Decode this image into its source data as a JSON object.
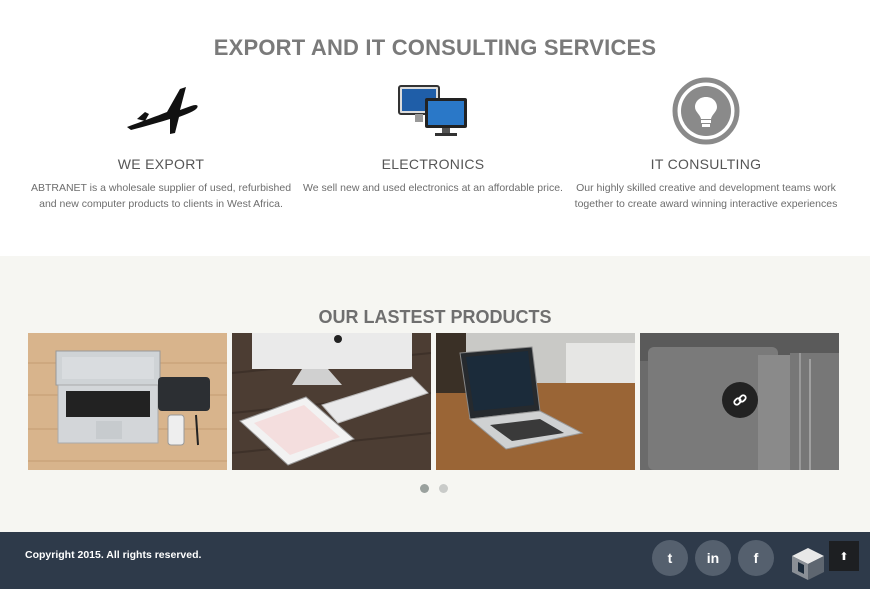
{
  "services": {
    "title": "EXPORT AND IT CONSULTING SERVICES",
    "items": [
      {
        "icon": "airplane-icon",
        "title": "WE EXPORT",
        "text_line1": "ABTRANET is a wholesale supplier of used, refurbished",
        "text_line2": "and new computer products to clients in West Africa."
      },
      {
        "icon": "monitors-icon",
        "title": "ELECTRONICS",
        "text_line1": "We sell new and used electronics at an affordable price.",
        "text_line2": ""
      },
      {
        "icon": "lightbulb-icon",
        "title": "IT CONSULTING",
        "text_line1": "Our highly skilled creative and development teams work",
        "text_line2": "together to create award winning interactive experiences"
      }
    ]
  },
  "products": {
    "title": "OUR LASTEST PRODUCTS",
    "items": [
      {
        "image": "laptop-on-wooden-desk"
      },
      {
        "image": "imac-keyboard-and-tablet"
      },
      {
        "image": "laptop-on-wooden-table"
      },
      {
        "image": "grey-laptop-closeup"
      }
    ],
    "carousel": {
      "pages": 2,
      "active": 1
    }
  },
  "footer": {
    "copyright": "Copyright 2015. All rights reserved.",
    "social": [
      {
        "name": "twitter",
        "glyph": "t"
      },
      {
        "name": "linkedin",
        "glyph": "in"
      },
      {
        "name": "facebook",
        "glyph": "f"
      }
    ],
    "scroll_top_glyph": "⬆"
  },
  "colors": {
    "footer_bg": "#2e3a4a",
    "products_bg": "#f6f6f2",
    "social_bg": "#55606e"
  }
}
